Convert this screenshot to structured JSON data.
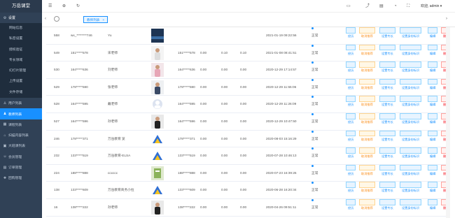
{
  "app": {
    "title": "万岳课堂"
  },
  "sidebar": {
    "group": {
      "label": "设置",
      "icon": "gear-icon"
    },
    "sub_items": [
      {
        "label": "网站信息"
      },
      {
        "label": "私密设置"
      },
      {
        "label": "授权验证"
      },
      {
        "label": "专长领域"
      },
      {
        "label": "幻灯片管理"
      },
      {
        "label": "上传设置"
      },
      {
        "label": "文件存储"
      }
    ],
    "items": [
      {
        "label": "用户列表",
        "icon": "user-icon",
        "active": false
      },
      {
        "label": "教师列表",
        "icon": "teacher-icon",
        "active": true
      },
      {
        "label": "课程列表",
        "icon": "course-icon",
        "active": false
      },
      {
        "label": "扫描内容列表",
        "icon": "scan-icon",
        "active": false
      },
      {
        "label": "大班课列表",
        "icon": "class-icon",
        "active": false
      },
      {
        "label": "会员管理",
        "icon": "member-icon",
        "active": false
      },
      {
        "label": "订单管理",
        "icon": "order-icon",
        "active": false
      },
      {
        "label": "团购管理",
        "icon": "group-icon",
        "active": false
      }
    ]
  },
  "header": {
    "user": "欢迎, admin"
  },
  "tags": {
    "active": "教师列表"
  },
  "table": {
    "status_label": "正常",
    "buttons": {
      "edit_resume": "经历",
      "cancel_rec": "取消推荐",
      "set_expert": "设置专长",
      "set_tag": "设置身份标识",
      "edit": "编辑",
      "delete": "删除"
    },
    "rows": [
      {
        "id": "558",
        "account": "wx_********746",
        "nickname": "Yu",
        "phone": "",
        "v1": "",
        "v2": "",
        "v3": "",
        "time": "2021-01-19 09:22:56",
        "avatar": "photo-dark"
      },
      {
        "id": "549",
        "account": "151*****578",
        "nickname": "宋老师",
        "phone": "151*****578",
        "v1": "0.00",
        "v2": "0.10",
        "v3": "0.10",
        "time": "2021-01-08 08:41:51",
        "avatar": "person"
      },
      {
        "id": "530",
        "account": "164*****636",
        "nickname": "刘老师",
        "phone": "164*****636",
        "v1": "0.00",
        "v2": "0.00",
        "v3": "0.00",
        "time": "2020-12-29 17:14:57",
        "avatar": "person-pink"
      },
      {
        "id": "529",
        "account": "178*****590",
        "nickname": "张老师",
        "phone": "178*****590",
        "v1": "0.00",
        "v2": "0.00",
        "v3": "0.00",
        "time": "2020-12-29 11:55:06",
        "avatar": "person-suit"
      },
      {
        "id": "528",
        "account": "164*****595",
        "nickname": "戴老师",
        "phone": "164*****595",
        "v1": "0.00",
        "v2": "0.00",
        "v3": "0.00",
        "time": "2020-12-29 11:26:09",
        "avatar": "default"
      },
      {
        "id": "527",
        "account": "164*****596",
        "nickname": "孙老师",
        "phone": "164*****596",
        "v1": "0.00",
        "v2": "0.00",
        "v3": "0.00",
        "time": "2020-12-29 10:47:50",
        "avatar": "person-dark"
      },
      {
        "id": "246",
        "account": "178*****371",
        "nickname": "万岳教育 览",
        "phone": "178*****371",
        "v1": "0.00",
        "v2": "0.00",
        "v3": "0.00",
        "time": "2020-08-03 15:16:29",
        "avatar": "logo"
      },
      {
        "id": "232",
        "account": "133*****519",
        "nickname": "万岳教育-ELSA",
        "phone": "133*****519",
        "v1": "0.00",
        "v2": "0.00",
        "v3": "0.00",
        "time": "2020-07-28 10:46:13",
        "avatar": "logo"
      },
      {
        "id": "224",
        "account": "188*****888",
        "nickname": "cccccc",
        "phone": "188*****888",
        "v1": "0.00",
        "v2": "0.00",
        "v3": "0.00",
        "time": "2020-07-23 16:39:26",
        "avatar": "book"
      },
      {
        "id": "138",
        "account": "133*****609",
        "nickname": "万岳教育商务小拉",
        "phone": "133*****609",
        "v1": "0.00",
        "v2": "0.00",
        "v3": "0.00",
        "time": "2020-06-28 16:20:34",
        "avatar": "logo"
      },
      {
        "id": "16",
        "account": "138*****222",
        "nickname": "孙老师",
        "phone": "138*****222",
        "v1": "0.00",
        "v2": "0.00",
        "v3": "0.00",
        "time": "2020-04-26 09:51:11",
        "avatar": "person-dark"
      }
    ]
  }
}
